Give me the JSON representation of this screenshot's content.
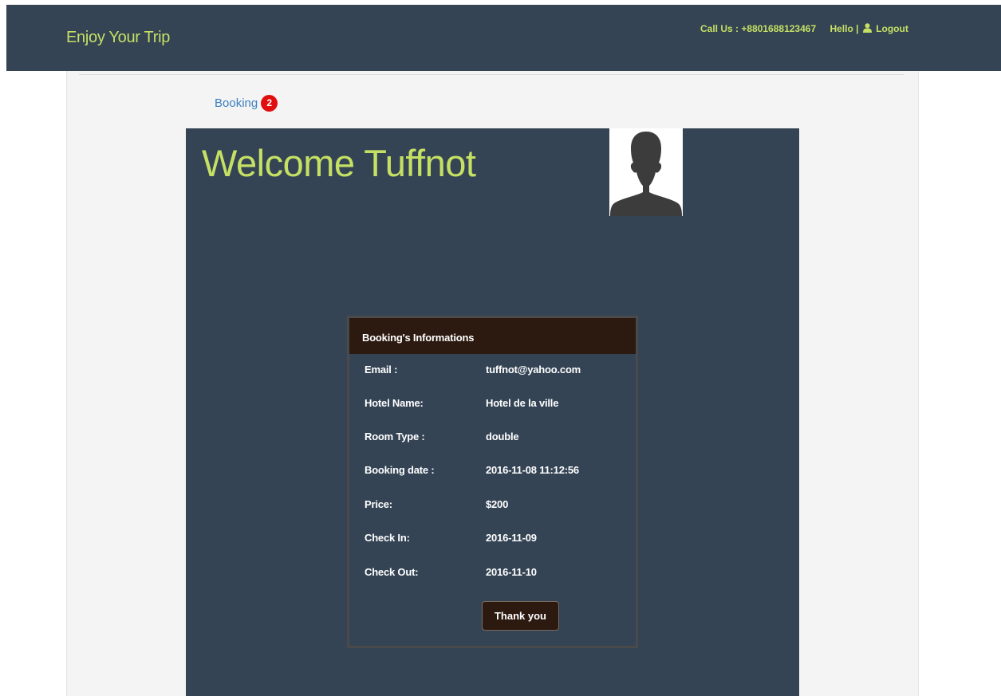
{
  "header": {
    "brand": "Enjoy Your Trip",
    "call_us": "Call Us : +8801688123467",
    "hello": "Hello |",
    "logout": "Logout",
    "accent_color": "#c5e063",
    "bar_color": "#344455"
  },
  "nav": {
    "booking_label": "Booking",
    "booking_count": "2"
  },
  "welcome": {
    "title": "Welcome Tuffnot",
    "avatar_icon": "user-silhouette-icon"
  },
  "booking_card": {
    "heading": "Booking's Informations",
    "rows": [
      {
        "label": "Email :",
        "value": "tuffnot@yahoo.com"
      },
      {
        "label": "Hotel Name:",
        "value": "Hotel de la ville"
      },
      {
        "label": "Room Type :",
        "value": "double"
      },
      {
        "label": "Booking date :",
        "value": "2016-11-08 11:12:56"
      },
      {
        "label": "Price:",
        "value": "$200"
      },
      {
        "label": "Check In:",
        "value": "2016-11-09"
      },
      {
        "label": "Check Out:",
        "value": "2016-11-10"
      }
    ],
    "button_label": "Thank you"
  }
}
